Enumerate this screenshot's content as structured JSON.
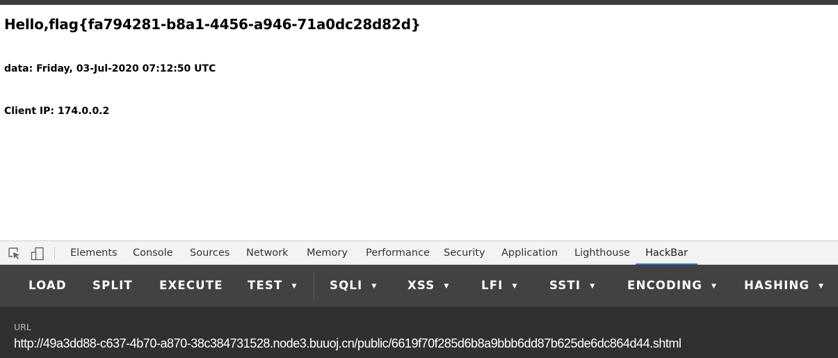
{
  "page": {
    "greeting": "Hello,flag{fa794281-b8a1-4456-a946-71a0dc28d82d}",
    "date_line": "data: Friday, 03-Jul-2020 07:12:50 UTC",
    "ip_line": "Client IP: 174.0.0.2"
  },
  "devtools": {
    "icons": [
      "inspect-element-icon",
      "device-toolbar-icon"
    ],
    "tabs": [
      "Elements",
      "Console",
      "Sources",
      "Network",
      "Memory",
      "Performance",
      "Security",
      "Application",
      "Lighthouse",
      "HackBar"
    ],
    "active_tab": "HackBar"
  },
  "hackbar": {
    "buttons": {
      "load": "LOAD",
      "split": "SPLIT",
      "execute": "EXECUTE",
      "test": "TEST",
      "sqli": "SQLI",
      "xss": "XSS",
      "lfi": "LFI",
      "ssti": "SSTI",
      "encoding": "ENCODING",
      "hashing": "HASHING"
    },
    "dropdown_icon": "caret-down-icon",
    "url_label": "URL",
    "url_value": "http://49a3dd88-c637-4b70-a870-38c384731528.node3.buuoj.cn/public/6619f70f285d6b8a9bbb6dd87b625de6dc864d44.shtml"
  },
  "colors": {
    "toolbar_bg": "#424242",
    "url_panel_bg": "#303030",
    "active_tab_underline": "#1a73e8",
    "devtools_tab_bg": "#f3f3f3"
  }
}
